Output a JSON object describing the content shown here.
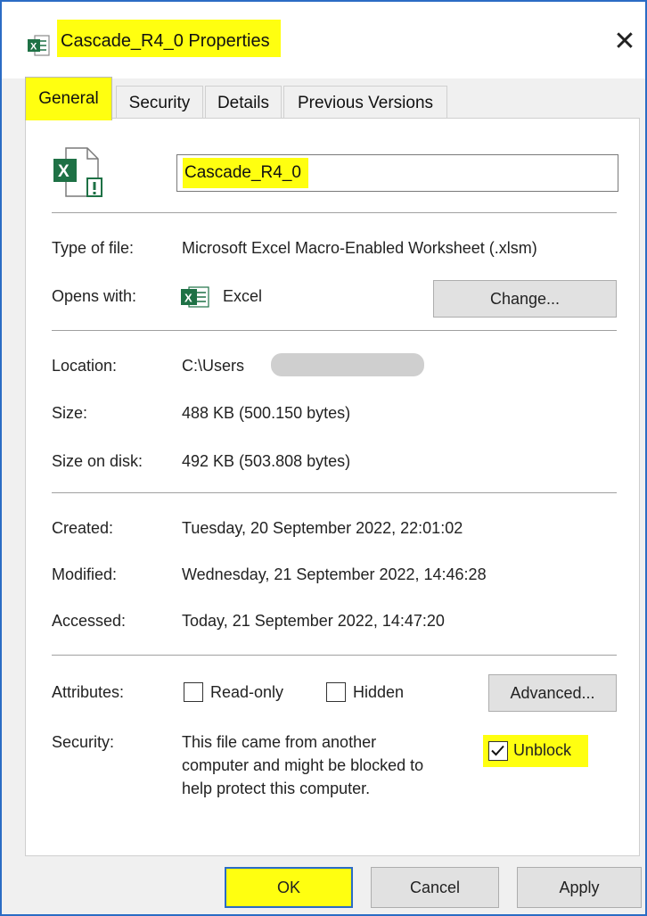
{
  "window": {
    "title": "Cascade_R4_0 Properties",
    "close_glyph": "✕"
  },
  "tabs": [
    {
      "label": "General",
      "active": true
    },
    {
      "label": "Security",
      "active": false
    },
    {
      "label": "Details",
      "active": false
    },
    {
      "label": "Previous Versions",
      "active": false
    }
  ],
  "general": {
    "file_name": "Cascade_R4_0",
    "type_of_file": {
      "label": "Type of file:",
      "value": "Microsoft Excel Macro-Enabled Worksheet (.xlsm)"
    },
    "opens_with": {
      "label": "Opens with:",
      "value": "Excel",
      "change_button": "Change..."
    },
    "location": {
      "label": "Location:",
      "value": "C:\\Users"
    },
    "size": {
      "label": "Size:",
      "value": "488 KB (500.150 bytes)"
    },
    "size_on_disk": {
      "label": "Size on disk:",
      "value": "492 KB (503.808 bytes)"
    },
    "created": {
      "label": "Created:",
      "value": "Tuesday, 20 September 2022, 22:01:02"
    },
    "modified": {
      "label": "Modified:",
      "value": "Wednesday, 21 September 2022, 14:46:28"
    },
    "accessed": {
      "label": "Accessed:",
      "value": "Today, 21 September 2022, 14:47:20"
    },
    "attributes": {
      "label": "Attributes:",
      "read_only": {
        "label": "Read-only",
        "checked": false
      },
      "hidden": {
        "label": "Hidden",
        "checked": false
      },
      "advanced_button": "Advanced..."
    },
    "security": {
      "label": "Security:",
      "message_lines": [
        "This file came from another",
        "computer and might be blocked to",
        "help protect this computer."
      ],
      "unblock": {
        "label": "Unblock",
        "checked": true
      }
    }
  },
  "buttons": {
    "ok": "OK",
    "cancel": "Cancel",
    "apply": "Apply"
  },
  "icons": {
    "app": "excel-file-icon",
    "large": "excel-macro-file-icon",
    "opens_with": "excel-icon"
  },
  "colors": {
    "highlight": "#ffff10",
    "excel_green": "#1e7145",
    "window_border": "#2b6cc4"
  }
}
